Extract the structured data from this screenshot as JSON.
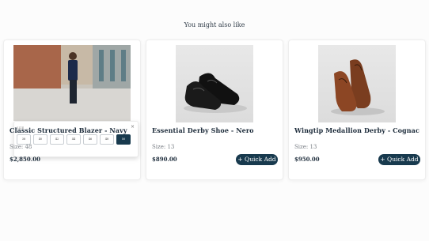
{
  "section_title": "You might also like",
  "products": [
    {
      "title": "Classic Structured Blazer - Navy",
      "size": "Size: 48",
      "price": "$2,850.00"
    },
    {
      "title": "Essential Derby Shoe - Nero",
      "size": "Size: 13",
      "price": "$890.00",
      "quick_add": "+ Quick Add"
    },
    {
      "title": "Wingtip Medallion Derby - Cognac",
      "size": "Size: 13",
      "price": "$950.00",
      "quick_add": "+ Quick Add"
    }
  ],
  "size_picker": {
    "label": "SIZE",
    "close": "×",
    "options": [
      "38",
      "40",
      "42",
      "44",
      "46",
      "48",
      "50"
    ],
    "selected": "50"
  },
  "colors": {
    "accent": "#183a4e"
  }
}
